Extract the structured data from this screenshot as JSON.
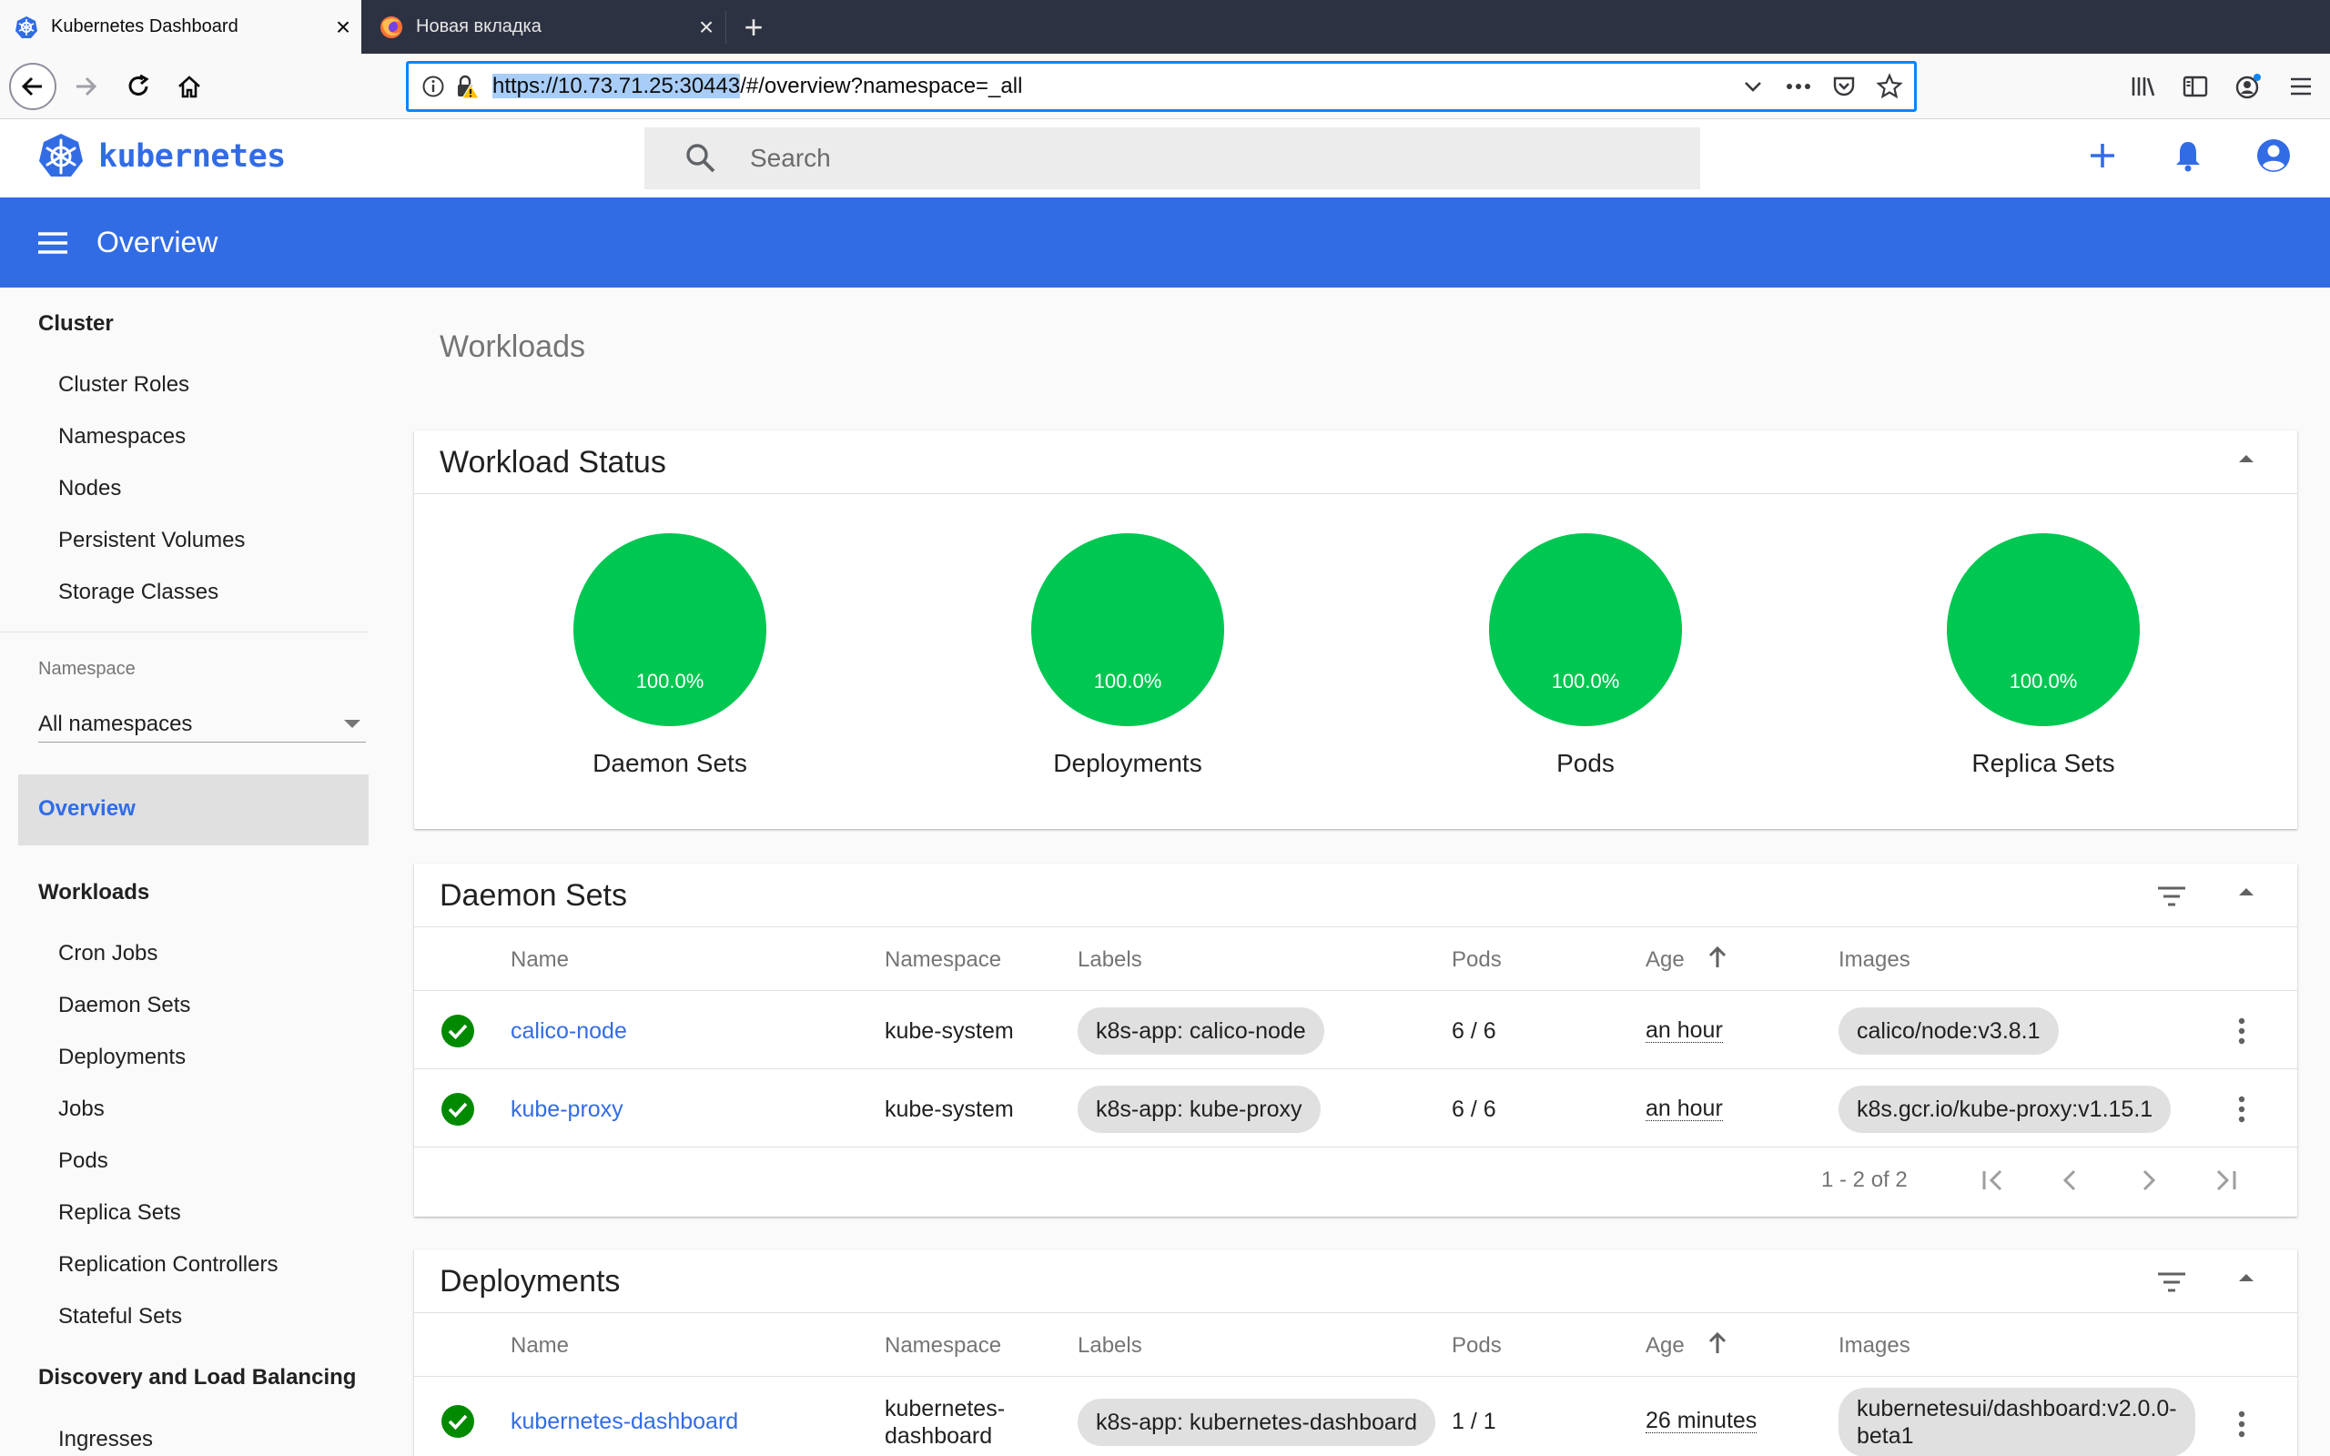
{
  "browser": {
    "tabs": [
      {
        "title": "Kubernetes Dashboard",
        "active": true
      },
      {
        "title": "Новая вкладка",
        "active": false
      }
    ],
    "url_highlight": "https://10.73.71.25:30443",
    "url_rest": "/#/overview?namespace=_all"
  },
  "header": {
    "brand": "kubernetes",
    "search_placeholder": "Search",
    "accent": "#326ce5"
  },
  "bar": {
    "title": "Overview"
  },
  "sidebar": {
    "cluster_heading": "Cluster",
    "cluster_items": [
      "Cluster Roles",
      "Namespaces",
      "Nodes",
      "Persistent Volumes",
      "Storage Classes"
    ],
    "namespace_label": "Namespace",
    "namespace_value": "All namespaces",
    "overview": "Overview",
    "workloads_heading": "Workloads",
    "workload_items": [
      "Cron Jobs",
      "Daemon Sets",
      "Deployments",
      "Jobs",
      "Pods",
      "Replica Sets",
      "Replication Controllers",
      "Stateful Sets"
    ],
    "discovery_heading": "Discovery and Load Balancing",
    "discovery_items": [
      "Ingresses"
    ]
  },
  "main": {
    "title": "Workloads",
    "workload_status": {
      "title": "Workload Status",
      "success_color": "#00c752",
      "items": [
        {
          "label": "Daemon Sets",
          "percent": "100.0%"
        },
        {
          "label": "Deployments",
          "percent": "100.0%"
        },
        {
          "label": "Pods",
          "percent": "100.0%"
        },
        {
          "label": "Replica Sets",
          "percent": "100.0%"
        }
      ]
    },
    "columns": {
      "name": "Name",
      "namespace": "Namespace",
      "labels": "Labels",
      "pods": "Pods",
      "age": "Age",
      "images": "Images"
    },
    "daemon_sets": {
      "title": "Daemon Sets",
      "rows": [
        {
          "name": "calico-node",
          "namespace": "kube-system",
          "label": "k8s-app: calico-node",
          "pods": "6 / 6",
          "age": "an hour",
          "image": "calico/node:v3.8.1"
        },
        {
          "name": "kube-proxy",
          "namespace": "kube-system",
          "label": "k8s-app: kube-proxy",
          "pods": "6 / 6",
          "age": "an hour",
          "image": "k8s.gcr.io/kube-proxy:v1.15.1"
        }
      ],
      "pagination": "1 - 2 of 2"
    },
    "deployments": {
      "title": "Deployments",
      "rows": [
        {
          "name": "kubernetes-dashboard",
          "namespace_line1": "kubernetes-",
          "namespace_line2": "dashboard",
          "label": "k8s-app: kubernetes-dashboard",
          "pods": "1 / 1",
          "age": "26 minutes",
          "image_line1": "kubernetesui/dashboard:v2.0.0-",
          "image_line2": "beta1"
        }
      ]
    }
  }
}
